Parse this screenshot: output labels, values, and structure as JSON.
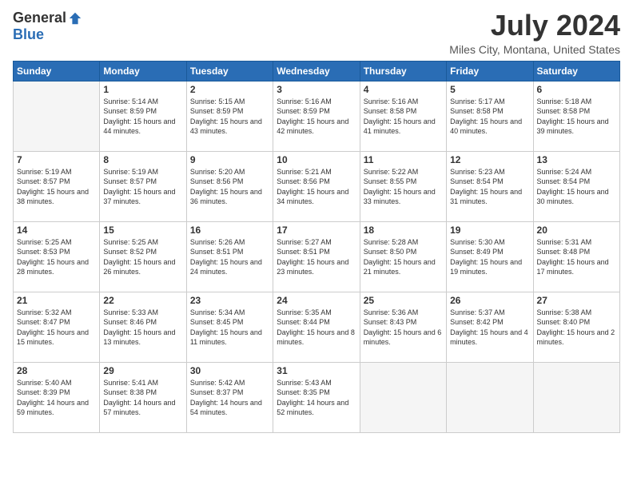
{
  "header": {
    "logo_general": "General",
    "logo_blue": "Blue",
    "title": "July 2024",
    "subtitle": "Miles City, Montana, United States"
  },
  "weekdays": [
    "Sunday",
    "Monday",
    "Tuesday",
    "Wednesday",
    "Thursday",
    "Friday",
    "Saturday"
  ],
  "weeks": [
    [
      {
        "day": "",
        "empty": true
      },
      {
        "day": "1",
        "sunrise": "5:14 AM",
        "sunset": "8:59 PM",
        "daylight": "15 hours and 44 minutes."
      },
      {
        "day": "2",
        "sunrise": "5:15 AM",
        "sunset": "8:59 PM",
        "daylight": "15 hours and 43 minutes."
      },
      {
        "day": "3",
        "sunrise": "5:16 AM",
        "sunset": "8:59 PM",
        "daylight": "15 hours and 42 minutes."
      },
      {
        "day": "4",
        "sunrise": "5:16 AM",
        "sunset": "8:58 PM",
        "daylight": "15 hours and 41 minutes."
      },
      {
        "day": "5",
        "sunrise": "5:17 AM",
        "sunset": "8:58 PM",
        "daylight": "15 hours and 40 minutes."
      },
      {
        "day": "6",
        "sunrise": "5:18 AM",
        "sunset": "8:58 PM",
        "daylight": "15 hours and 39 minutes."
      }
    ],
    [
      {
        "day": "7",
        "sunrise": "5:19 AM",
        "sunset": "8:57 PM",
        "daylight": "15 hours and 38 minutes."
      },
      {
        "day": "8",
        "sunrise": "5:19 AM",
        "sunset": "8:57 PM",
        "daylight": "15 hours and 37 minutes."
      },
      {
        "day": "9",
        "sunrise": "5:20 AM",
        "sunset": "8:56 PM",
        "daylight": "15 hours and 36 minutes."
      },
      {
        "day": "10",
        "sunrise": "5:21 AM",
        "sunset": "8:56 PM",
        "daylight": "15 hours and 34 minutes."
      },
      {
        "day": "11",
        "sunrise": "5:22 AM",
        "sunset": "8:55 PM",
        "daylight": "15 hours and 33 minutes."
      },
      {
        "day": "12",
        "sunrise": "5:23 AM",
        "sunset": "8:54 PM",
        "daylight": "15 hours and 31 minutes."
      },
      {
        "day": "13",
        "sunrise": "5:24 AM",
        "sunset": "8:54 PM",
        "daylight": "15 hours and 30 minutes."
      }
    ],
    [
      {
        "day": "14",
        "sunrise": "5:25 AM",
        "sunset": "8:53 PM",
        "daylight": "15 hours and 28 minutes."
      },
      {
        "day": "15",
        "sunrise": "5:25 AM",
        "sunset": "8:52 PM",
        "daylight": "15 hours and 26 minutes."
      },
      {
        "day": "16",
        "sunrise": "5:26 AM",
        "sunset": "8:51 PM",
        "daylight": "15 hours and 24 minutes."
      },
      {
        "day": "17",
        "sunrise": "5:27 AM",
        "sunset": "8:51 PM",
        "daylight": "15 hours and 23 minutes."
      },
      {
        "day": "18",
        "sunrise": "5:28 AM",
        "sunset": "8:50 PM",
        "daylight": "15 hours and 21 minutes."
      },
      {
        "day": "19",
        "sunrise": "5:30 AM",
        "sunset": "8:49 PM",
        "daylight": "15 hours and 19 minutes."
      },
      {
        "day": "20",
        "sunrise": "5:31 AM",
        "sunset": "8:48 PM",
        "daylight": "15 hours and 17 minutes."
      }
    ],
    [
      {
        "day": "21",
        "sunrise": "5:32 AM",
        "sunset": "8:47 PM",
        "daylight": "15 hours and 15 minutes."
      },
      {
        "day": "22",
        "sunrise": "5:33 AM",
        "sunset": "8:46 PM",
        "daylight": "15 hours and 13 minutes."
      },
      {
        "day": "23",
        "sunrise": "5:34 AM",
        "sunset": "8:45 PM",
        "daylight": "15 hours and 11 minutes."
      },
      {
        "day": "24",
        "sunrise": "5:35 AM",
        "sunset": "8:44 PM",
        "daylight": "15 hours and 8 minutes."
      },
      {
        "day": "25",
        "sunrise": "5:36 AM",
        "sunset": "8:43 PM",
        "daylight": "15 hours and 6 minutes."
      },
      {
        "day": "26",
        "sunrise": "5:37 AM",
        "sunset": "8:42 PM",
        "daylight": "15 hours and 4 minutes."
      },
      {
        "day": "27",
        "sunrise": "5:38 AM",
        "sunset": "8:40 PM",
        "daylight": "15 hours and 2 minutes."
      }
    ],
    [
      {
        "day": "28",
        "sunrise": "5:40 AM",
        "sunset": "8:39 PM",
        "daylight": "14 hours and 59 minutes."
      },
      {
        "day": "29",
        "sunrise": "5:41 AM",
        "sunset": "8:38 PM",
        "daylight": "14 hours and 57 minutes."
      },
      {
        "day": "30",
        "sunrise": "5:42 AM",
        "sunset": "8:37 PM",
        "daylight": "14 hours and 54 minutes."
      },
      {
        "day": "31",
        "sunrise": "5:43 AM",
        "sunset": "8:35 PM",
        "daylight": "14 hours and 52 minutes."
      },
      {
        "day": "",
        "empty": true
      },
      {
        "day": "",
        "empty": true
      },
      {
        "day": "",
        "empty": true
      }
    ]
  ]
}
